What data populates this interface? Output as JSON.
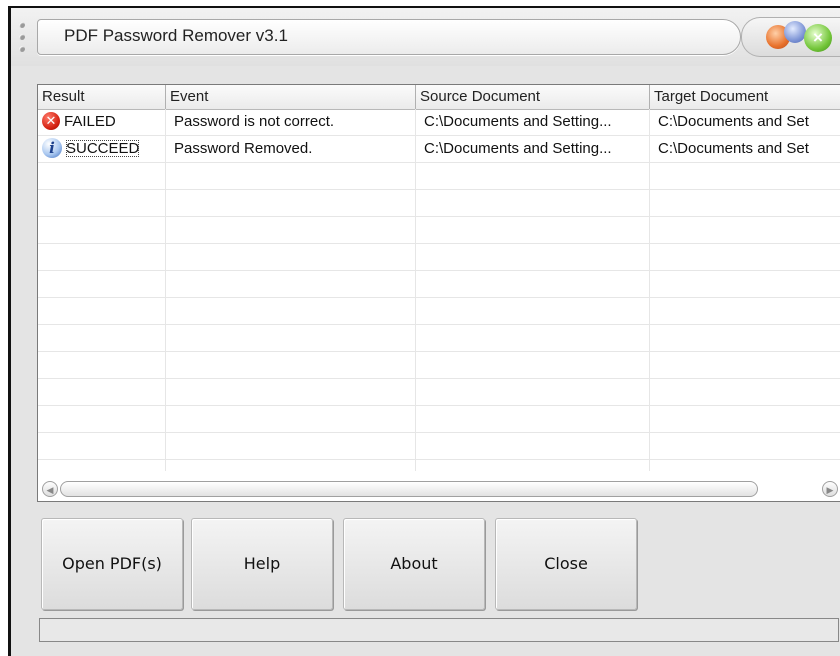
{
  "window": {
    "title": "PDF Password Remover v3.1",
    "controls": {
      "close_glyph": "×"
    }
  },
  "list": {
    "columns": [
      "Result",
      "Event",
      "Source Document",
      "Target Document"
    ],
    "rows": [
      {
        "icon": "error-icon",
        "result": "FAILED",
        "event": "Password is not correct.",
        "source": "C:\\Documents and Setting...",
        "target": "C:\\Documents and Set"
      },
      {
        "icon": "info-icon",
        "result": "SUCCEED",
        "event": "Password Removed.",
        "source": "C:\\Documents and Setting...",
        "target": "C:\\Documents and Set"
      }
    ],
    "scrollbar": {
      "left_glyph": "◀",
      "right_glyph": "▶"
    }
  },
  "buttons": {
    "open": "Open PDF(s)",
    "help": "Help",
    "about": "About",
    "close": "Close"
  },
  "status": {
    "text": ""
  },
  "icons": {
    "fail_glyph": "✕",
    "info_glyph": "i"
  },
  "colors": {
    "window_bg": "#e4e4e4",
    "error_red": "#d32010",
    "info_blue": "#3a6cc0",
    "ctrl_orange": "#e8722c",
    "ctrl_blue": "#7e95d6",
    "ctrl_green": "#74c63a"
  }
}
